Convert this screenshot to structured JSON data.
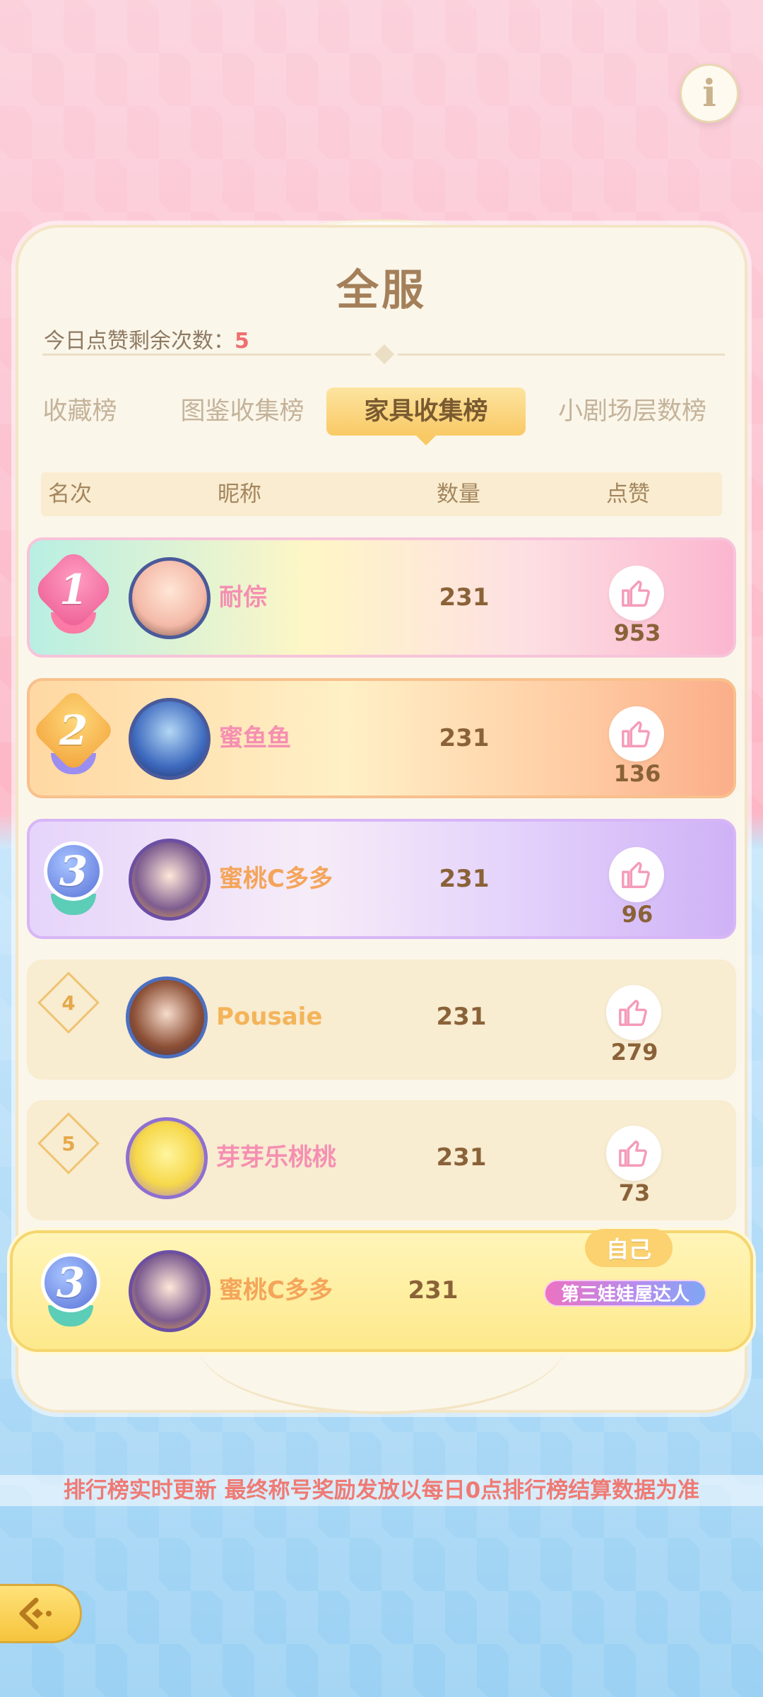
{
  "header": {
    "info_icon": "info-icon"
  },
  "panel": {
    "title": "全服",
    "likes_remaining_label": "今日点赞剩余次数：",
    "likes_remaining_value": "5"
  },
  "tabs": [
    {
      "label": "收藏榜",
      "active": false
    },
    {
      "label": "图鉴收集榜",
      "active": false
    },
    {
      "label": "家具收集榜",
      "active": true
    },
    {
      "label": "小剧场层数榜",
      "active": false
    }
  ],
  "columns": {
    "rank": "名次",
    "nickname": "昵称",
    "count": "数量",
    "likes": "点赞"
  },
  "rows": [
    {
      "rank": "1",
      "nickname": "耐倧",
      "count": "231",
      "likes": "953",
      "name_color": "#f58fb2"
    },
    {
      "rank": "2",
      "nickname": "蜜鱼鱼",
      "count": "231",
      "likes": "136",
      "name_color": "#f58fb2"
    },
    {
      "rank": "3",
      "nickname": "蜜桃C多多",
      "count": "231",
      "likes": "96",
      "name_color": "#f4a55a"
    },
    {
      "rank": "4",
      "nickname": "Pousaie",
      "count": "231",
      "likes": "279",
      "name_color": "#f4b45a"
    },
    {
      "rank": "5",
      "nickname": "芽芽乐桃桃",
      "count": "231",
      "likes": "73",
      "name_color": "#f58fb2"
    }
  ],
  "self": {
    "tag": "自己",
    "rank": "3",
    "nickname": "蜜桃C多多",
    "count": "231",
    "title_badge": "第三娃娃屋达人"
  },
  "footer": {
    "notice": "排行榜实时更新 最终称号奖励发放以每日0点排行榜结算数据为准",
    "back_icon": "back-arrow-icon"
  },
  "colors": {
    "accent": "#f9c965",
    "like_icon": "#f9a8c0",
    "count_text": "#8a6238"
  }
}
